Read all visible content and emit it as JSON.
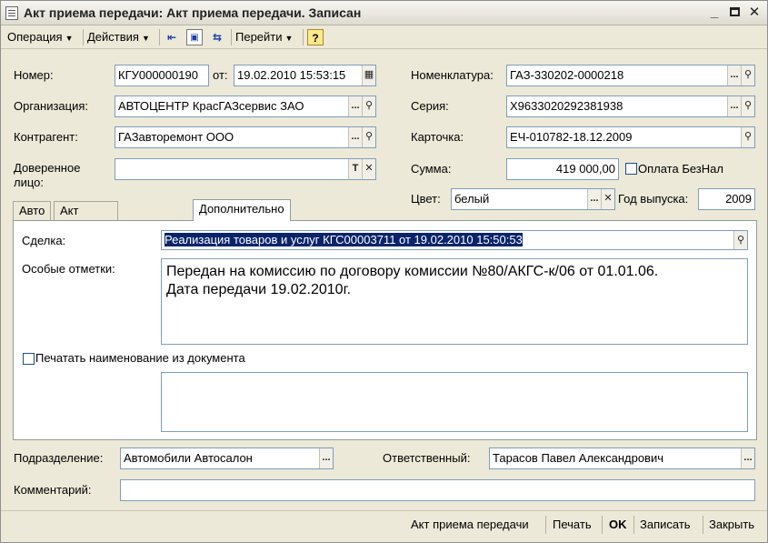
{
  "window": {
    "title": "Акт приема передачи: Акт приема передачи. Записан"
  },
  "toolbar": {
    "operation": "Операция",
    "actions": "Действия",
    "goto": "Перейти",
    "help": "?"
  },
  "header": {
    "number_label": "Номер:",
    "number_value": "КГУ000000190",
    "date_label": "от:",
    "date_value": "19.02.2010 15:53:15",
    "org_label": "Организация:",
    "org_value": "АВТОЦЕНТР КрасГАЗсервис ЗАО",
    "contractor_label": "Контрагент:",
    "contractor_value": "ГАЗавторемонт ООО",
    "trustee_label_1": "Доверенное",
    "trustee_label_2": "лицо:",
    "trustee_value": "",
    "nomenclature_label": "Номенклатура:",
    "nomenclature_value": "ГАЗ-330202-0000218",
    "series_label": "Серия:",
    "series_value": "X9633020292381938",
    "card_label": "Карточка:",
    "card_value": "ЕЧ-010782-18.12.2009",
    "sum_label": "Сумма:",
    "sum_value": "419 000,00",
    "cashless_label": "Оплата БезНал",
    "color_label": "Цвет:",
    "color_value": "белый",
    "year_label": "Год выпуска:",
    "year_value": "2009"
  },
  "tabs": [
    {
      "label": "Авто"
    },
    {
      "label": "Акт приема передачи"
    },
    {
      "label": "Дополнительно"
    }
  ],
  "additional": {
    "deal_label": "Сделка:",
    "deal_value": "Реализация товаров и услуг КГС00003711 от 19.02.2010 15:50:53",
    "notes_label": "Особые отметки:",
    "notes_value": "Передан на комиссию по договору комиссии №80/АКГС-к/06 от 01.01.06.\nДата передачи 19.02.2010г.",
    "print_name_label": "Печатать наименование из документа",
    "print_name_text": ""
  },
  "footer": {
    "department_label": "Подразделение:",
    "department_value": "Автомобили Автосалон",
    "responsible_label": "Ответственный:",
    "responsible_value": "Тарасов Павел Александрович",
    "comment_label": "Комментарий:",
    "comment_value": ""
  },
  "buttons": {
    "act": "Акт приема передачи",
    "print": "Печать",
    "ok": "OK",
    "save": "Записать",
    "close": "Закрыть"
  },
  "colors": {
    "selection": "#0a246a",
    "window_bg": "#ece9d8"
  }
}
